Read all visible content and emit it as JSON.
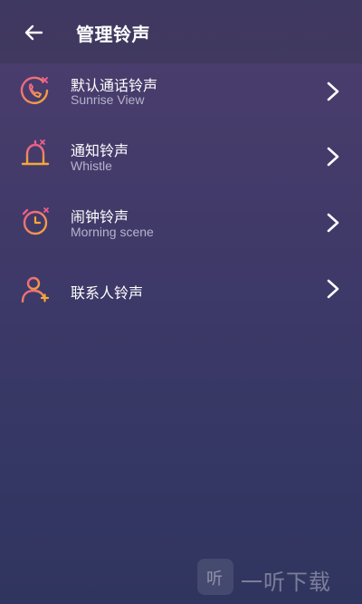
{
  "header": {
    "title": "管理铃声",
    "back_icon": "arrow-left-icon"
  },
  "items": [
    {
      "label": "默认通话铃声",
      "subtitle": "Sunrise View",
      "icon": "phone-ringing-icon"
    },
    {
      "label": "通知铃声",
      "subtitle": "Whistle",
      "icon": "bell-icon"
    },
    {
      "label": "闹钟铃声",
      "subtitle": "Morning scene",
      "icon": "alarm-clock-icon"
    },
    {
      "label": "联系人铃声",
      "subtitle": "",
      "icon": "contact-person-icon"
    }
  ],
  "watermark": {
    "logo_text": "听",
    "text": "一听下载"
  },
  "colors": {
    "accent_orange": "#f4a83a",
    "accent_pink": "#e95f8a",
    "background_top": "#4a3e6e",
    "background_bottom": "#30355f"
  }
}
